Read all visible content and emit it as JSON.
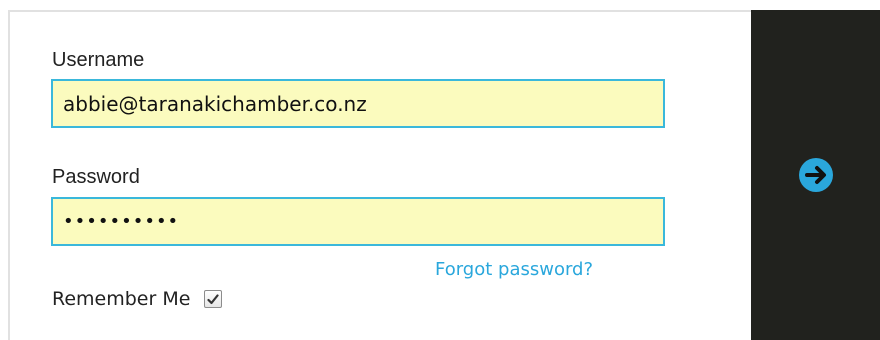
{
  "login": {
    "username_label": "Username",
    "username_value": "abbie@taranakichamber.co.nz",
    "password_label": "Password",
    "password_value": "••••••••••",
    "forgot_password_text": "Forgot password?",
    "remember_me_label": "Remember Me",
    "remember_me_checked": true
  },
  "submit": {
    "icon": "arrow-right-circle-icon",
    "panel_color": "#21221e",
    "icon_color": "#2aa7dc"
  },
  "colors": {
    "input_background": "#fbfbbe",
    "input_border": "#3ab8db",
    "link": "#2aa7dc"
  }
}
